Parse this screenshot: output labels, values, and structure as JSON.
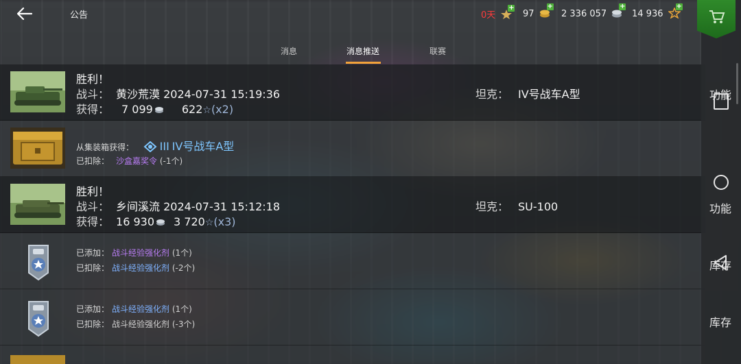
{
  "header": {
    "title": "公告",
    "resources": {
      "premium_days": "0天",
      "gold": "97",
      "silver": "2 336 057",
      "free_xp": "14 936"
    }
  },
  "tabs": [
    {
      "label": "消息",
      "active": false
    },
    {
      "label": "消息推送",
      "active": true
    },
    {
      "label": "联赛",
      "active": false
    }
  ],
  "messages": [
    {
      "type": "battle",
      "title": "胜利！",
      "battle_label": "战斗：",
      "battle_map": "黄沙荒漠",
      "battle_time": "2024-07-31 15:19:36",
      "earned_label": "获得：",
      "silver": "7 099",
      "xp": "622",
      "xp_mult": "(x2)",
      "tank_label": "坦克：",
      "tank": "IV号战车A型"
    },
    {
      "type": "container",
      "got_label": "从集装箱获得：",
      "tier": "III",
      "tank": "IV号战车A型",
      "deducted_label": "已扣除：",
      "deducted_item": "沙盒嘉奖令",
      "deducted_count": "(-1个)"
    },
    {
      "type": "battle",
      "title": "胜利！",
      "battle_label": "战斗：",
      "battle_map": "乡间溪流",
      "battle_time": "2024-07-31 15:12:18",
      "earned_label": "获得：",
      "silver": "16 930",
      "xp": "3 720",
      "xp_mult": "(x3)",
      "tank_label": "坦克：",
      "tank": "SU-100"
    },
    {
      "type": "booster",
      "added_label": "已添加：",
      "added_item": "战斗经验强化剂",
      "added_count": "(1个)",
      "deducted_label": "已扣除：",
      "deducted_item": "战斗经验强化剂",
      "deducted_count": "(-2个)"
    },
    {
      "type": "booster",
      "added_label": "已添加：",
      "added_item": "战斗经验强化剂",
      "added_count": "(1个)",
      "deducted_label": "已扣除：",
      "deducted_item": "战斗经验强化剂",
      "deducted_count": "(-3个)"
    }
  ],
  "sidebar": {
    "labels": [
      "功能",
      "功能",
      "库存",
      "库存"
    ]
  },
  "icons": {
    "back": "arrow-left-icon",
    "shop": "cart-icon",
    "gold": "gold-coins-icon",
    "silver": "silver-coins-icon",
    "free_xp": "star-icon",
    "premium": "premium-icon"
  },
  "colors": {
    "tab_active_underline": "#f2a23a",
    "premium_days": "#ff3b3b",
    "purple_item": "#b77cf2",
    "blue_item": "#7fb2ff",
    "shop_green": "#2f8a2a"
  }
}
